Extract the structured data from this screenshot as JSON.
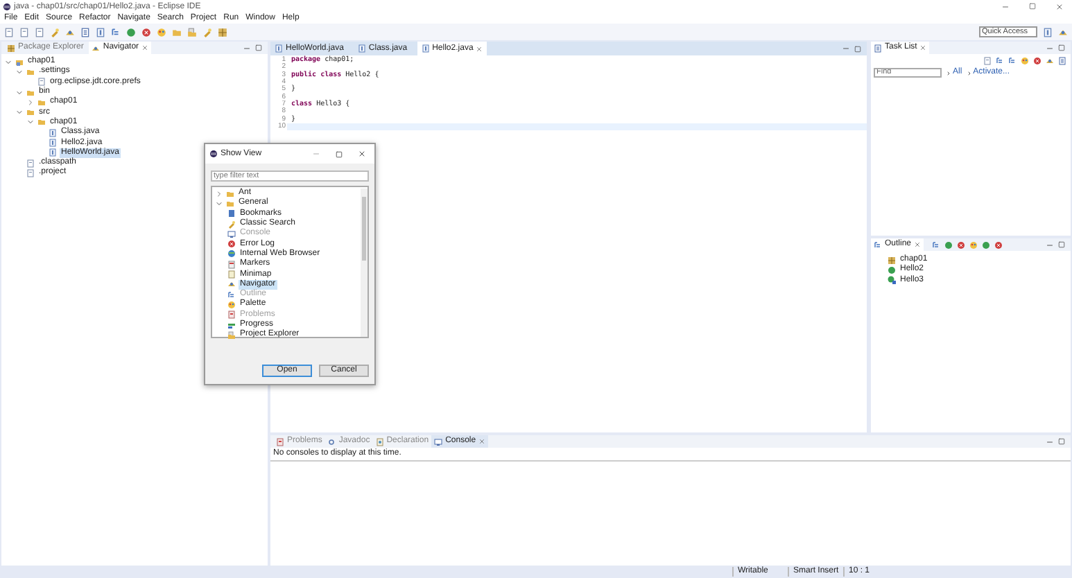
{
  "window": {
    "title": "java - chap01/src/chap01/Hello2.java - Eclipse IDE"
  },
  "menu": [
    "File",
    "Edit",
    "Source",
    "Refactor",
    "Navigate",
    "Search",
    "Project",
    "Run",
    "Window",
    "Help"
  ],
  "quick_access": {
    "placeholder": "Quick Access"
  },
  "left_panel": {
    "tabs": [
      {
        "label": "Package Explorer",
        "kind": "package",
        "selected": false
      },
      {
        "label": "Navigator",
        "kind": "navigator",
        "selected": true
      }
    ],
    "tree": [
      {
        "label": "chap01",
        "kind": "project",
        "expanded": true,
        "selected": false,
        "children": [
          {
            "label": ".settings",
            "kind": "folder",
            "expanded": true,
            "selected": false,
            "children": [
              {
                "label": "org.eclipse.jdt.core.prefs",
                "kind": "file",
                "selected": false
              }
            ]
          },
          {
            "label": "bin",
            "kind": "folder",
            "expanded": true,
            "selected": false,
            "children": [
              {
                "label": "chap01",
                "kind": "folder",
                "expanded": false,
                "selected": false
              }
            ]
          },
          {
            "label": "src",
            "kind": "folder",
            "expanded": true,
            "selected": false,
            "children": [
              {
                "label": "chap01",
                "kind": "folder",
                "expanded": true,
                "selected": false,
                "children": [
                  {
                    "label": "Class.java",
                    "kind": "java",
                    "selected": false
                  },
                  {
                    "label": "Hello2.java",
                    "kind": "java",
                    "selected": false
                  },
                  {
                    "label": "HelloWorld.java",
                    "kind": "java",
                    "selected": true
                  }
                ]
              }
            ]
          },
          {
            "label": ".classpath",
            "kind": "file",
            "selected": false
          },
          {
            "label": ".project",
            "kind": "file",
            "selected": false
          }
        ]
      }
    ]
  },
  "editor": {
    "tabs": [
      {
        "label": "HelloWorld.java",
        "selected": false
      },
      {
        "label": "Class.java",
        "selected": false
      },
      {
        "label": "Hello2.java",
        "selected": true
      }
    ],
    "lines": [
      {
        "number": "1",
        "current": false,
        "tokens": [
          {
            "kind": "keyword",
            "text": "package"
          },
          {
            "kind": "plain",
            "text": " chap01;"
          }
        ]
      },
      {
        "number": "2",
        "current": false
      },
      {
        "number": "3",
        "current": false,
        "tokens": [
          {
            "kind": "keyword",
            "text": "public class"
          },
          {
            "kind": "plain",
            "text": " Hello2 {"
          }
        ]
      },
      {
        "number": "4",
        "current": false
      },
      {
        "number": "5",
        "current": false,
        "tokens": [
          {
            "kind": "plain",
            "text": "}"
          }
        ]
      },
      {
        "number": "6",
        "current": false
      },
      {
        "number": "7",
        "current": false,
        "tokens": [
          {
            "kind": "keyword",
            "text": "class"
          },
          {
            "kind": "plain",
            "text": " Hello3 {"
          }
        ]
      },
      {
        "number": "8",
        "current": false
      },
      {
        "number": "9",
        "current": false,
        "tokens": [
          {
            "kind": "plain",
            "text": "}"
          }
        ]
      },
      {
        "number": "10",
        "current": true
      }
    ]
  },
  "task_list": {
    "title": "Task List",
    "find": {
      "placeholder": "Find"
    },
    "links": [
      "All",
      "Activate..."
    ]
  },
  "outline": {
    "title": "Outline",
    "items": [
      {
        "label": "chap01",
        "kind": "package"
      },
      {
        "label": "Hello2",
        "kind": "class"
      },
      {
        "label": "Hello3",
        "kind": "class2"
      }
    ]
  },
  "console": {
    "tabs": [
      {
        "label": "Problems",
        "kind": "problems",
        "selected": false
      },
      {
        "label": "Javadoc",
        "kind": "javadoc",
        "selected": false
      },
      {
        "label": "Declaration",
        "kind": "declaration",
        "selected": false
      },
      {
        "label": "Console",
        "kind": "console",
        "selected": true
      }
    ],
    "message": "No consoles to display at this time."
  },
  "status_bar": [
    "Writable",
    "Smart Insert",
    "10 : 1"
  ],
  "dialog": {
    "title": "Show View",
    "filter": {
      "placeholder": "type filter text"
    },
    "items": [
      {
        "label": "Ant",
        "kind": "folder",
        "expanded": false,
        "selected": false,
        "disabled": false
      },
      {
        "label": "General",
        "kind": "folder",
        "expanded": true,
        "selected": false,
        "disabled": false,
        "children": [
          {
            "label": "Bookmarks",
            "kind": "bookmarks",
            "selected": false,
            "disabled": false
          },
          {
            "label": "Classic Search",
            "kind": "search",
            "selected": false,
            "disabled": false
          },
          {
            "label": "Console",
            "kind": "console",
            "selected": false,
            "disabled": true
          },
          {
            "label": "Error Log",
            "kind": "error",
            "selected": false,
            "disabled": false
          },
          {
            "label": "Internal Web Browser",
            "kind": "browser",
            "selected": false,
            "disabled": false
          },
          {
            "label": "Markers",
            "kind": "markers",
            "selected": false,
            "disabled": false
          },
          {
            "label": "Minimap",
            "kind": "minimap",
            "selected": false,
            "disabled": false
          },
          {
            "label": "Navigator",
            "kind": "navigator",
            "selected": true,
            "disabled": false
          },
          {
            "label": "Outline",
            "kind": "outline",
            "selected": false,
            "disabled": true
          },
          {
            "label": "Palette",
            "kind": "palette",
            "selected": false,
            "disabled": false
          },
          {
            "label": "Problems",
            "kind": "problems",
            "selected": false,
            "disabled": true
          },
          {
            "label": "Progress",
            "kind": "progress",
            "selected": false,
            "disabled": false
          },
          {
            "label": "Project Explorer",
            "kind": "explorer",
            "selected": false,
            "disabled": false
          }
        ]
      }
    ],
    "buttons": [
      "Open",
      "Cancel"
    ]
  }
}
